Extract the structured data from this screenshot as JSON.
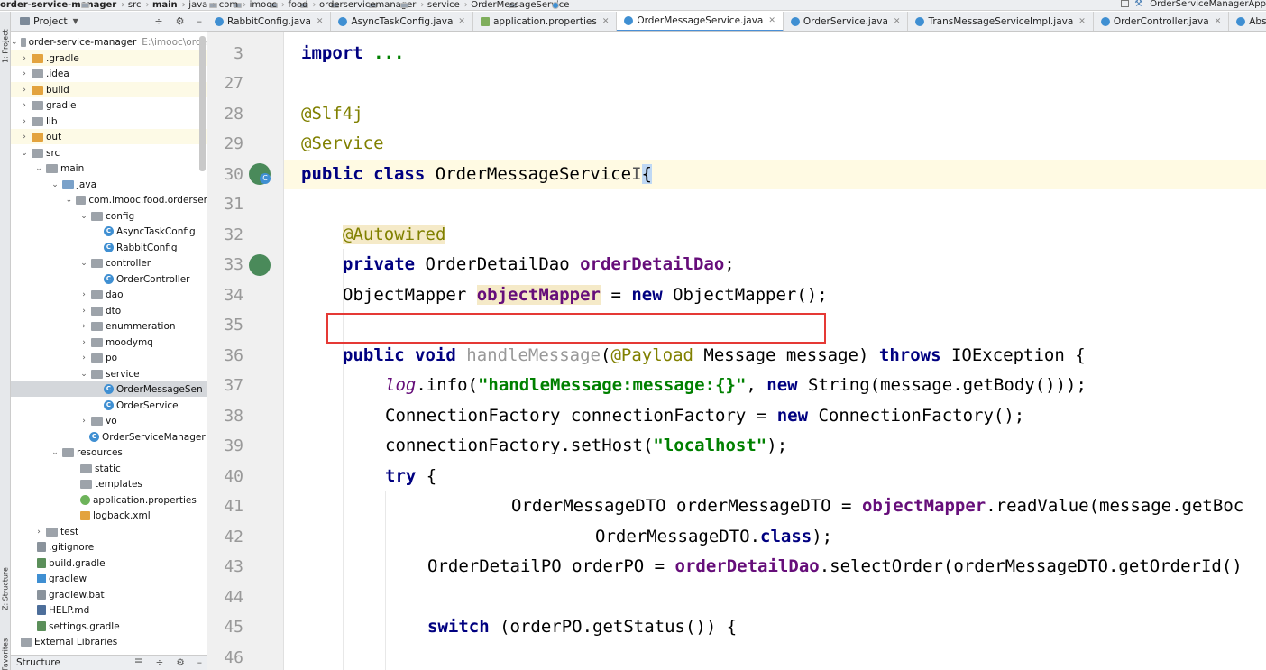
{
  "breadcrumb": [
    "order-service-manager",
    "src",
    "main",
    "java",
    "com",
    "imooc",
    "food",
    "orderservicemanager",
    "service",
    "OrderMessageService"
  ],
  "run_config": "OrderServiceManagerApp",
  "side_labels": {
    "project": "1: Project",
    "structure": "Z: Structure",
    "favorites": "Favorites"
  },
  "project_panel": {
    "title": "Project",
    "tree": [
      {
        "label": "order-service-manager",
        "path": "E:\\imooc\\orde"
      },
      {
        "label": ".gradle"
      },
      {
        "label": ".idea"
      },
      {
        "label": "build"
      },
      {
        "label": "gradle"
      },
      {
        "label": "lib"
      },
      {
        "label": "out"
      },
      {
        "label": "src"
      },
      {
        "label": "main"
      },
      {
        "label": "java"
      },
      {
        "label": "com.imooc.food.orderser"
      },
      {
        "label": "config"
      },
      {
        "label": "AsyncTaskConfig"
      },
      {
        "label": "RabbitConfig"
      },
      {
        "label": "controller"
      },
      {
        "label": "OrderController"
      },
      {
        "label": "dao"
      },
      {
        "label": "dto"
      },
      {
        "label": "enummeration"
      },
      {
        "label": "moodymq"
      },
      {
        "label": "po"
      },
      {
        "label": "service"
      },
      {
        "label": "OrderMessageSen"
      },
      {
        "label": "OrderService"
      },
      {
        "label": "vo"
      },
      {
        "label": "OrderServiceManager"
      },
      {
        "label": "resources"
      },
      {
        "label": "static"
      },
      {
        "label": "templates"
      },
      {
        "label": "application.properties"
      },
      {
        "label": "logback.xml"
      },
      {
        "label": "test"
      },
      {
        "label": ".gitignore"
      },
      {
        "label": "build.gradle"
      },
      {
        "label": "gradlew"
      },
      {
        "label": "gradlew.bat"
      },
      {
        "label": "HELP.md"
      },
      {
        "label": "settings.gradle"
      },
      {
        "label": "External Libraries"
      }
    ],
    "structure_label": "Structure"
  },
  "tabs": [
    {
      "label": "RabbitConfig.java"
    },
    {
      "label": "AsyncTaskConfig.java"
    },
    {
      "label": "application.properties"
    },
    {
      "label": "OrderMessageService.java"
    },
    {
      "label": "OrderService.java"
    },
    {
      "label": "TransMessageServiceImpl.java"
    },
    {
      "label": "OrderController.java"
    },
    {
      "label": "AbstractMessageListen"
    }
  ],
  "line_numbers": [
    "3",
    "27",
    "28",
    "29",
    "30",
    "31",
    "32",
    "33",
    "34",
    "35",
    "36",
    "37",
    "38",
    "39",
    "40",
    "41",
    "42",
    "43",
    "44",
    "45",
    "46"
  ],
  "code": {
    "l3a": "import",
    "l3b": " ...",
    "l28": "@Slf4j",
    "l29": "@Service",
    "l30a": "public class",
    "l30b": " OrderMessageService",
    "l30c": "I",
    "l30d": "{",
    "l32": "@Autowired",
    "l33a": "private",
    "l33b": " OrderDetailDao ",
    "l33c": "orderDetailDao",
    "l33d": ";",
    "l34a": "ObjectMapper ",
    "l34b": "objectMapper",
    "l34c": " = ",
    "l34d": "new",
    "l34e": " ObjectMapper();",
    "l36a": "public void",
    "l36b": " handleMessage",
    "l36c": "(",
    "l36d": "@Payload",
    "l36e": " Message message) ",
    "l36f": "throws",
    "l36g": " IOException {",
    "l37a": "log",
    "l37b": ".info(",
    "l37c": "\"handleMessage:message:{}\"",
    "l37d": ", ",
    "l37e": "new",
    "l37f": " String(message.getBody()));",
    "l38a": "ConnectionFactory connectionFactory = ",
    "l38b": "new",
    "l38c": " ConnectionFactory();",
    "l39a": "connectionFactory.setHost(",
    "l39b": "\"localhost\"",
    "l39c": ");",
    "l40a": "try",
    "l40b": " {",
    "l41a": "OrderMessageDTO orderMessageDTO = ",
    "l41b": "objectMapper",
    "l41c": ".readValue(message.getBoc",
    "l42a": "OrderMessageDTO.",
    "l42b": "class",
    "l42c": ");",
    "l43a": "OrderDetailPO orderPO = ",
    "l43b": "orderDetailDao",
    "l43c": ".selectOrder(orderMessageDTO.getOrderId()",
    "l45a": "switch",
    "l45b": " (orderPO.getStatus()) {"
  }
}
